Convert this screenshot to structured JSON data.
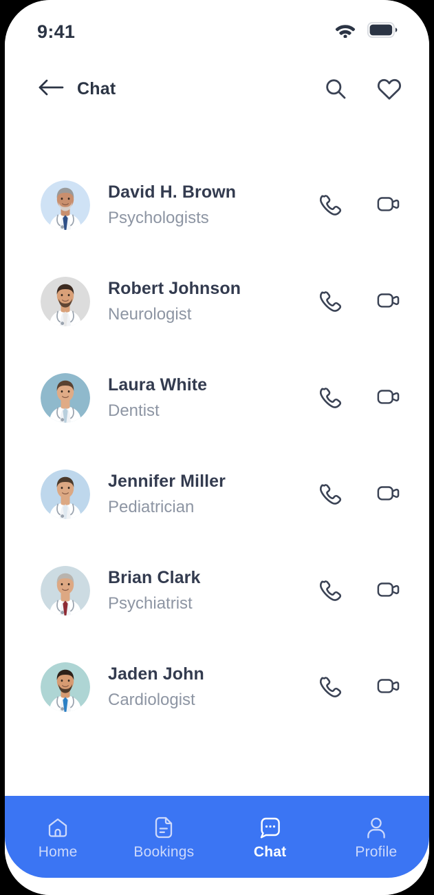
{
  "status_bar": {
    "time": "9:41",
    "wifi_icon": "wifi-icon",
    "battery_icon": "battery-full-icon"
  },
  "header": {
    "back_icon": "arrow-left-icon",
    "title": "Chat",
    "search_icon": "search-icon",
    "favorite_icon": "heart-icon"
  },
  "chat_list": {
    "call_icon": "phone-icon",
    "video_icon": "video-camera-icon",
    "items": [
      {
        "name": "David H. Brown",
        "role": "Psychologists",
        "avatar_bg": "#cfe2f5",
        "skin": "#c98f6e",
        "hair": "#9a9a9a",
        "beard": "#d8d8d8",
        "tie": "#2f4f86"
      },
      {
        "name": "Robert Johnson",
        "role": "Neurologist",
        "avatar_bg": "#dcdcdc",
        "skin": "#d9a078",
        "hair": "#3b2a20",
        "beard": "#4a3527",
        "tie": "#e8e8e8"
      },
      {
        "name": "Laura White",
        "role": "Dentist",
        "avatar_bg": "#8fb9cc",
        "skin": "#e0ab86",
        "hair": "#5a4231",
        "beard": "none",
        "tie": "#b9cfdd"
      },
      {
        "name": "Jennifer Miller",
        "role": "Pediatrician",
        "avatar_bg": "#bed7ec",
        "skin": "#dca883",
        "hair": "#4b3a2c",
        "beard": "none",
        "tie": "#dfe8f0"
      },
      {
        "name": "Brian Clark",
        "role": "Psychiatrist",
        "avatar_bg": "#ccdbe2",
        "skin": "#dda883",
        "hair": "#b9b4ae",
        "beard": "none",
        "tie": "#8e2b34"
      },
      {
        "name": "Jaden John",
        "role": "Cardiologist",
        "avatar_bg": "#aed5d4",
        "skin": "#d79b72",
        "hair": "#2e2119",
        "beard": "#3a2a1e",
        "tie": "#2b7fc4"
      }
    ]
  },
  "bottom_nav": {
    "items": [
      {
        "label": "Home",
        "icon": "home-icon",
        "active": false
      },
      {
        "label": "Bookings",
        "icon": "document-icon",
        "active": false
      },
      {
        "label": "Chat",
        "icon": "chat-bubble-icon",
        "active": true
      },
      {
        "label": "Profile",
        "icon": "person-icon",
        "active": false
      }
    ]
  },
  "colors": {
    "accent": "#3b75f3",
    "title": "#2b3444",
    "name": "#333b4f",
    "role": "#8d95a3",
    "nav_inactive": "#cdd9fb",
    "screen_bg": "#ffffff"
  }
}
